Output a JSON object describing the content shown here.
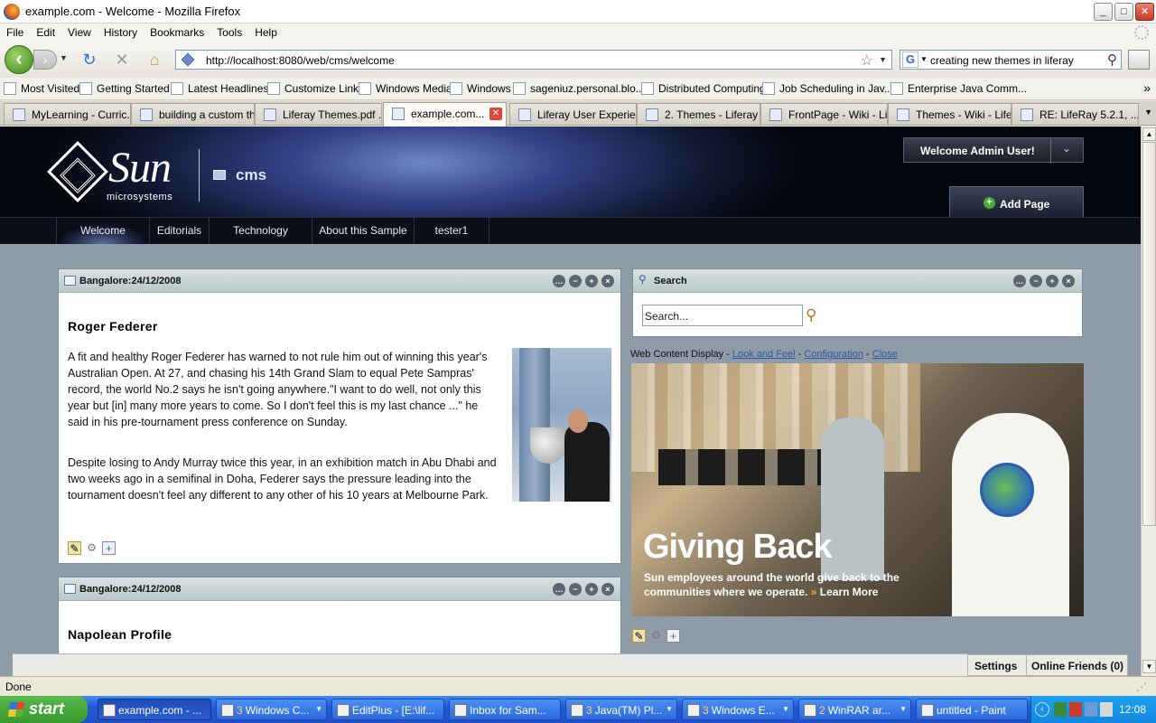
{
  "window": {
    "title": "example.com - Welcome - Mozilla Firefox",
    "controls": [
      "_",
      "□",
      "✕"
    ]
  },
  "menu": [
    "File",
    "Edit",
    "View",
    "History",
    "Bookmarks",
    "Tools",
    "Help"
  ],
  "nav": {
    "url": "http://localhost:8080/web/cms/welcome",
    "search_query": "creating new themes in liferay",
    "search_engine": "G"
  },
  "bookmarks": [
    "Most Visited",
    "Getting Started",
    "Latest Headlines",
    "Customize Links",
    "Windows Media",
    "Windows",
    "sageniuz.personal.blo...",
    "Distributed Computing",
    "Job Scheduling in Jav...",
    "Enterprise Java Comm..."
  ],
  "tabs": [
    "MyLearning - Curric...",
    "building a custom th...",
    "Liferay Themes.pdf ...",
    "example.com...",
    "Liferay User Experie...",
    "2. Themes - Liferay ...",
    "FrontPage - Wiki - Li...",
    "Themes - Wiki - Lifer...",
    "RE: LifeRay 5.2.1, ..."
  ],
  "portal": {
    "logo_word": "Sun",
    "logo_sub": "microsystems",
    "community": "cms",
    "welcome_user": "Welcome Admin User!",
    "add_page": "Add Page",
    "nav_items": [
      "Welcome",
      "Editorials",
      "Technology",
      "About this Sample",
      "tester1"
    ]
  },
  "article1": {
    "portlet_title": "Bangalore:24/12/2008",
    "headline": "Roger Federer",
    "p1": "A fit and healthy Roger Federer has warned to not rule him out of winning this year's Australian Open. At 27, and chasing his 14th Grand Slam to equal Pete Sampras' record, the world No.2 says he isn't going anywhere.\"I want to do well, not only this year but [in] many more years to come. So I don't feel this is my last chance ...\" he said in his pre-tournament press conference on Sunday.",
    "p2": "Despite losing to Andy Murray twice this year, in an exhibition match in Abu Dhabi and two weeks ago in a semifinal in Doha, Federer says the pressure leading into the tournament doesn't feel any different to any other of his 10 years at Melbourne Park."
  },
  "article2": {
    "portlet_title": "Bangalore:24/12/2008",
    "headline": "Napolean Profile"
  },
  "search_portlet": {
    "title": "Search",
    "placeholder": "Search..."
  },
  "wcd": {
    "label": "Web Content Display",
    "sep": " - ",
    "links": [
      "Look and Feel",
      "Configuration",
      "Close"
    ]
  },
  "banner": {
    "title": "Giving Back",
    "subtitle": "Sun employees around the world give back to the communities where we operate.",
    "link": "Learn More",
    "link_glyph": "»"
  },
  "dock": {
    "settings": "Settings",
    "online_friends": "Online Friends (0)"
  },
  "status": "Done",
  "taskbar": {
    "start": "start",
    "tasks": [
      {
        "count": "",
        "label": "example.com - ..."
      },
      {
        "count": "3",
        "label": "Windows C..."
      },
      {
        "count": "",
        "label": "EditPlus - [E:\\lif..."
      },
      {
        "count": "",
        "label": "Inbox for Sam..."
      },
      {
        "count": "3",
        "label": "Java(TM) Pl..."
      },
      {
        "count": "3",
        "label": "Windows E..."
      },
      {
        "count": "2",
        "label": "WinRAR ar..."
      },
      {
        "count": "",
        "label": "untitled - Paint"
      }
    ],
    "clock": "12:08"
  }
}
